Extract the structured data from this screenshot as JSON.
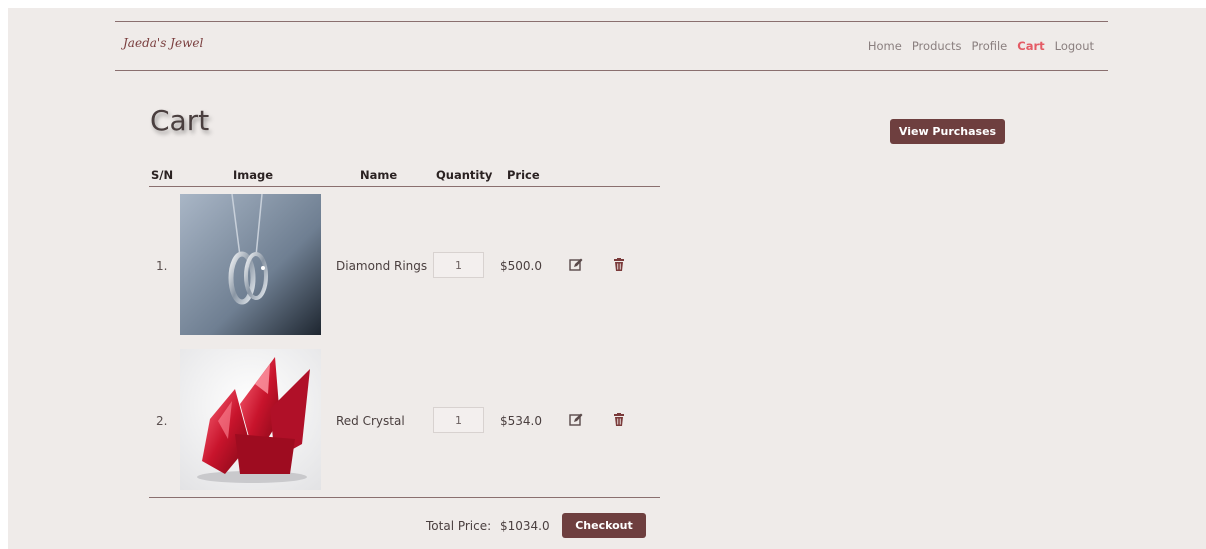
{
  "brand": "Jaeda's Jewel",
  "nav": {
    "items": [
      "Home",
      "Products",
      "Profile",
      "Cart",
      "Logout"
    ],
    "active": "Cart",
    "active_color": "#e45b65"
  },
  "page_title": "Cart",
  "view_purchases_label": "View Purchases",
  "table": {
    "headers": [
      "S/N",
      "Image",
      "Name",
      "Quantity",
      "Price"
    ],
    "rows": [
      {
        "sn": "1.",
        "image": "silver-ring-necklace",
        "name": "Diamond Rings",
        "quantity": "1",
        "price": "$500.0"
      },
      {
        "sn": "2.",
        "image": "red-crystal",
        "name": "Red Crystal",
        "quantity": "1",
        "price": "$534.0"
      }
    ]
  },
  "total": {
    "label": "Total Price:",
    "value": "$1034.0"
  },
  "checkout_label": "Checkout",
  "colors": {
    "accent": "#6e3f3f",
    "background": "#efebe9"
  },
  "icons": {
    "edit": "edit-icon",
    "delete": "trash-icon"
  }
}
